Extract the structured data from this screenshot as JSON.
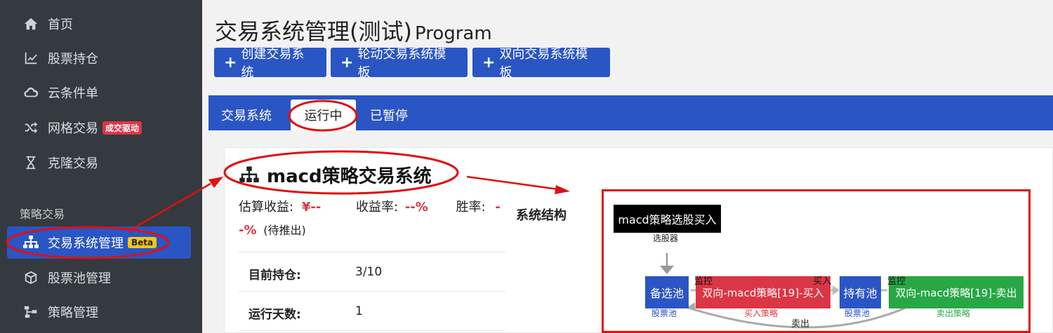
{
  "sidebar": {
    "items": [
      {
        "label": "首页",
        "icon": "home-icon"
      },
      {
        "label": "股票持仓",
        "icon": "chart-line-icon"
      },
      {
        "label": "云条件单",
        "icon": "cloud-icon"
      },
      {
        "label": "网格交易",
        "icon": "shuffle-icon",
        "badge": "成交驱动"
      },
      {
        "label": "克隆交易",
        "icon": "hourglass-icon"
      }
    ],
    "section_label": "策略交易",
    "active_item": {
      "label": "交易系统管理",
      "icon": "sitemap-icon",
      "badge": "Beta"
    },
    "lower_items": [
      {
        "label": "股票池管理",
        "icon": "cube-icon"
      },
      {
        "label": "策略管理",
        "icon": "network-icon"
      }
    ]
  },
  "header": {
    "title": "交易系统管理(测试)",
    "subtitle": "Program"
  },
  "toolbar": {
    "create_label": "创建交易系统",
    "rotation_label": "轮动交易系统模板",
    "bidirectional_label": "双向交易系统模板"
  },
  "tabs": {
    "systems": "交易系统",
    "running": "运行中",
    "paused": "已暂停"
  },
  "system": {
    "name": "macd策略交易系统",
    "est_profit_label": "估算收益:",
    "est_profit_value": "¥--",
    "yield_label": "收益率:",
    "yield_value": "--%",
    "winrate_label": "胜率:",
    "winrate_value_a": "-",
    "winrate_value_b": "-%",
    "pending_note": "(待推出)",
    "holdings_label": "目前持仓:",
    "holdings_value": "3/10",
    "days_label": "运行天数:",
    "days_value": "1",
    "structure_label": "系统结构"
  },
  "diagram": {
    "selector_node": "macd策略选股买入",
    "selector_caption": "选股器",
    "candidate_node": "备选池",
    "candidate_caption": "股票池",
    "buy_node": "双向-macd策略[19]-买入",
    "buy_caption": "买入策略",
    "monitor_label_1": "监控",
    "buy_arrow_label": "买入",
    "holding_node": "持有池",
    "holding_caption": "股票池",
    "monitor_label_2": "监控",
    "sell_node": "双向-macd策略[19]-卖出",
    "sell_caption": "卖出策略",
    "sell_arrow_label": "卖出"
  },
  "colors": {
    "sidebar_bg": "#343a40",
    "primary": "#2a55c4",
    "danger": "#dc3545",
    "success": "#28a745",
    "annotation": "#e01010"
  }
}
